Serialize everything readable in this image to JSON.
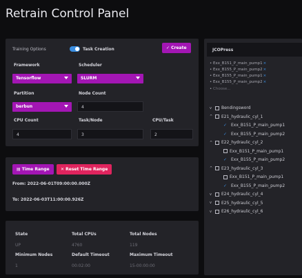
{
  "page_title": "Retrain Control Panel",
  "training": {
    "options_label": "Training Options",
    "toggle_label": "Task Creation",
    "create_label": "Create",
    "framework_label": "Framework",
    "framework_value": "Tensorflow",
    "scheduler_label": "Scheduler",
    "scheduler_value": "SLURM",
    "partition_label": "Partition",
    "partition_value": "berbun",
    "node_count_label": "Node Count",
    "node_count_value": "4",
    "cpu_count_label": "CPU Count",
    "cpu_count_value": "4",
    "task_node_label": "Task/Node",
    "task_node_value": "3",
    "cpu_task_label": "CPU/Task",
    "cpu_task_value": "2"
  },
  "time_range": {
    "time_range_label": "Time Range",
    "reset_label": "Reset Time Range",
    "from_text": "From: 2022-06-01T09:00:00.000Z",
    "to_text": "To: 2022-06-03T11:00:00.926Z"
  },
  "stats": {
    "headers": [
      "State",
      "Total CPUs",
      "Total Nodes"
    ],
    "values": [
      "UP",
      "4760",
      "119"
    ],
    "headers2": [
      "Minimum Nodes",
      "Default Timeout",
      "Maximum Timeout"
    ],
    "values2": [
      "1",
      "00:02:00",
      "15-00:00:00"
    ]
  },
  "jco": {
    "title": "JCOPress",
    "chips": [
      "Exx_B151_P_main_pump1",
      "Exx_B155_P_main_pump2",
      "Exx_B155_P_main_pump1",
      "Exx_B155_P_main_pump2"
    ],
    "choose_placeholder": "Choose...",
    "tree": [
      {
        "chev": "v",
        "mark": "box",
        "label": "Bendingsword",
        "indent": 0
      },
      {
        "chev": "^",
        "mark": "box",
        "label": "E21_hydraulic_cyl_1",
        "indent": 0
      },
      {
        "chev": "",
        "mark": "check",
        "label": "Exx_B151_P_main_pump1",
        "indent": 1
      },
      {
        "chev": "",
        "mark": "check",
        "label": "Exx_B155_P_main_pump2",
        "indent": 1
      },
      {
        "chev": "^",
        "mark": "box",
        "label": "E22_hydraulic_cyl_2",
        "indent": 0
      },
      {
        "chev": "",
        "mark": "box",
        "label": "Exx_B151_P_main_pump1",
        "indent": 1
      },
      {
        "chev": "",
        "mark": "check",
        "label": "Exx_B155_P_main_pump2",
        "indent": 1
      },
      {
        "chev": "^",
        "mark": "box",
        "label": "E23_hydraulic_cyl_3",
        "indent": 0
      },
      {
        "chev": "",
        "mark": "box",
        "label": "Exx_B151_P_main_pump1",
        "indent": 1
      },
      {
        "chev": "",
        "mark": "check",
        "label": "Exx_B155_P_main_pump2",
        "indent": 1
      },
      {
        "chev": "v",
        "mark": "box",
        "label": "E24_hydraulic_cyl_4",
        "indent": 0
      },
      {
        "chev": "v",
        "mark": "box",
        "label": "E25_hydraulic_cyl_5",
        "indent": 0
      },
      {
        "chev": "v",
        "mark": "box",
        "label": "E26_hydraulic_cyl_6",
        "indent": 0
      }
    ]
  },
  "colors": {
    "accent_purple": "#a316b4",
    "accent_pink": "#e0245e",
    "accent_blue": "#3a8de0",
    "card_bg": "#232328",
    "page_bg": "#0d0d0f"
  }
}
